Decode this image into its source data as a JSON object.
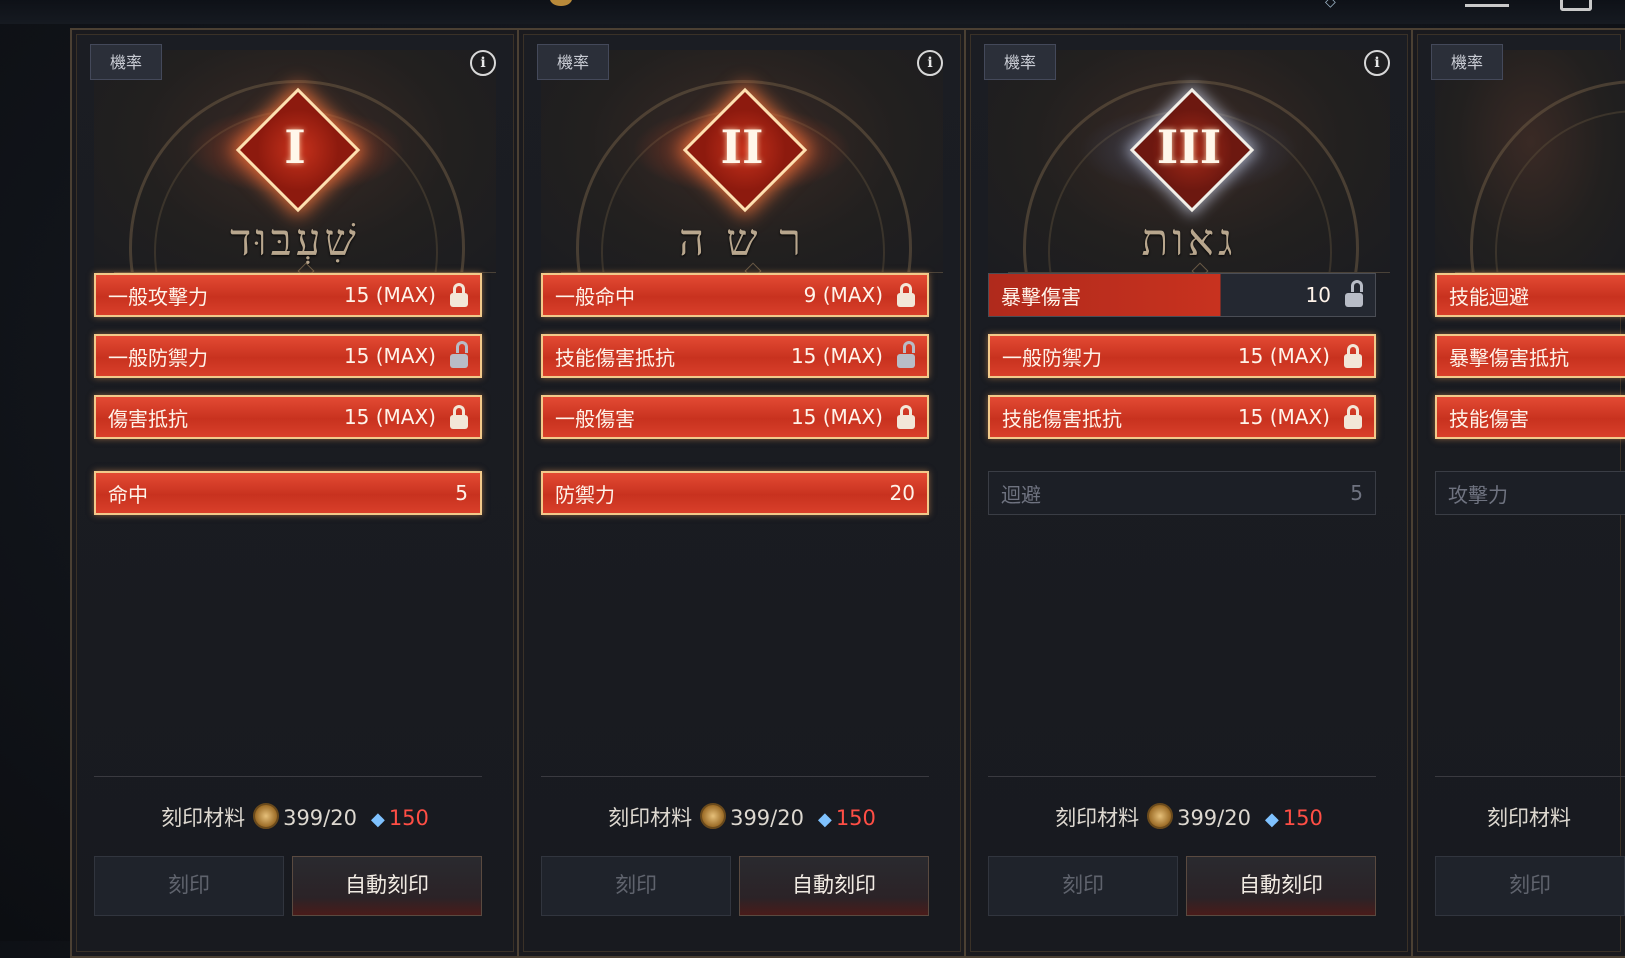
{
  "cards": [
    {
      "tag": "機率",
      "numeral": "I",
      "rune": "שִׁעְבּוּד",
      "stats": [
        {
          "name": "一般攻擊力",
          "value": "15 (MAX)",
          "lock": "locked"
        },
        {
          "name": "一般防禦力",
          "value": "15 (MAX)",
          "lock": "unlocked"
        },
        {
          "name": "傷害抵抗",
          "value": "15 (MAX)",
          "lock": "locked"
        }
      ],
      "extra": {
        "name": "命中",
        "value": "5"
      },
      "material_label": "刻印材料",
      "material_count": "399/20",
      "gem_cost": "150",
      "engrave_label": "刻印",
      "auto_label": "自動刻印"
    },
    {
      "tag": "機率",
      "numeral": "II",
      "rune": "ר ש ה",
      "stats": [
        {
          "name": "一般命中",
          "value": "9 (MAX)",
          "lock": "locked"
        },
        {
          "name": "技能傷害抵抗",
          "value": "15 (MAX)",
          "lock": "unlocked"
        },
        {
          "name": "一般傷害",
          "value": "15 (MAX)",
          "lock": "locked"
        }
      ],
      "extra": {
        "name": "防禦力",
        "value": "20"
      },
      "material_label": "刻印材料",
      "material_count": "399/20",
      "gem_cost": "150",
      "engrave_label": "刻印",
      "auto_label": "自動刻印"
    },
    {
      "tag": "機率",
      "numeral": "III",
      "rune": "גאות",
      "stats": [
        {
          "name": "暴擊傷害",
          "value": "10",
          "lock": "unlocked",
          "fill_fraction": 0.6
        },
        {
          "name": "一般防禦力",
          "value": "15 (MAX)",
          "lock": "locked"
        },
        {
          "name": "技能傷害抵抗",
          "value": "15 (MAX)",
          "lock": "locked"
        }
      ],
      "extra": {
        "name": "迴避",
        "value": "5"
      },
      "material_label": "刻印材料",
      "material_count": "399/20",
      "gem_cost": "150",
      "engrave_label": "刻印",
      "auto_label": "自動刻印"
    },
    {
      "tag": "機率",
      "stats": [
        {
          "name": "技能迴避"
        },
        {
          "name": "暴擊傷害抵抗"
        },
        {
          "name": "技能傷害"
        }
      ],
      "extra": {
        "name": "攻擊力"
      },
      "material_label": "刻印材料",
      "engrave_label": "刻印"
    }
  ],
  "colors": {
    "active_bar": "#d93f2a",
    "gem_cost": "#ff4e45",
    "frame": "#4b4033"
  }
}
